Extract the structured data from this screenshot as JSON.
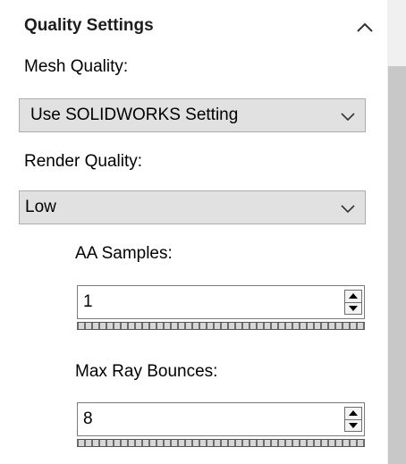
{
  "section": {
    "title": "Quality Settings",
    "collapse_icon": "chevron-up-icon"
  },
  "mesh_quality": {
    "label": "Mesh Quality:",
    "value": "Use SOLIDWORKS Setting"
  },
  "render_quality": {
    "label": "Render Quality:",
    "value": "Low"
  },
  "aa_samples": {
    "label": "AA Samples:",
    "value": "1"
  },
  "max_ray_bounces": {
    "label": "Max Ray Bounces:",
    "value": "8"
  },
  "colors": {
    "dropdown_bg": "#e1e1e1",
    "panel_bg": "#ffffff",
    "scrollbar_thumb": "#c8c8c8"
  }
}
